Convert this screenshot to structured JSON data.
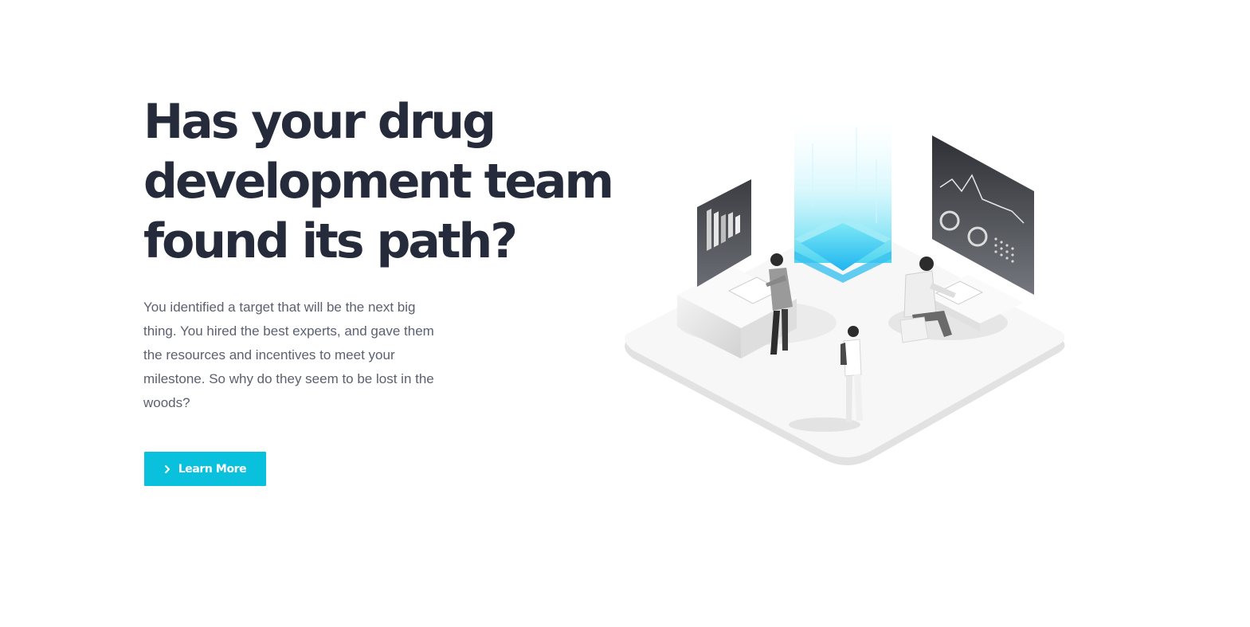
{
  "hero": {
    "headline": {
      "line1": "Has your drug",
      "line2": "development team",
      "line3": "found its path?"
    },
    "description": "You identified a target that will be the next big thing. You hired the best experts, and gave them the resources and incentives to meet your milestone. So why do they seem to be lost in the woods?",
    "cta": {
      "label": "Learn More",
      "icon": "chevron-right-icon"
    }
  },
  "colors": {
    "accent": "#09c1dc",
    "heading": "#252b3b",
    "body_text": "#5c6070",
    "background": "#ffffff"
  },
  "illustration": {
    "icon": "isometric-lab-illustration"
  }
}
